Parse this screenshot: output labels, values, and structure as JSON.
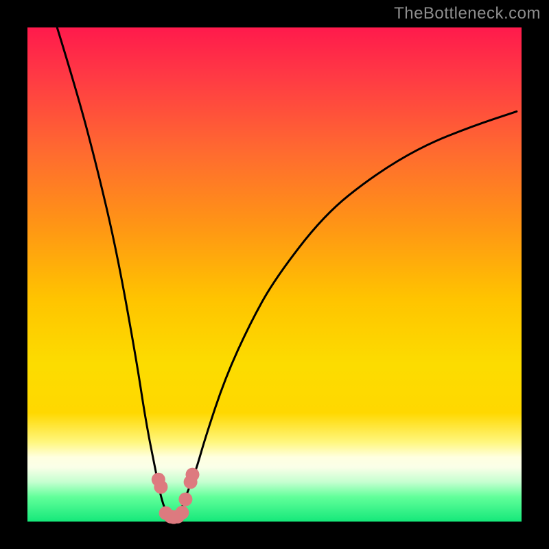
{
  "attribution": "TheBottleneck.com",
  "colors": {
    "frame": "#000000",
    "gradient_top": "#ff1a4c",
    "gradient_mid": "#ffc400",
    "gradient_low": "#fff780",
    "gradient_bottom": "#15e87a",
    "curve_stroke": "#000000",
    "marker_fill": "#dd7a7f"
  },
  "chart_data": {
    "type": "line",
    "title": "",
    "xlabel": "",
    "ylabel": "",
    "xlim": [
      0,
      100
    ],
    "ylim": [
      0,
      100
    ],
    "grid": false,
    "legend": false,
    "series": [
      {
        "name": "bottleneck-curve",
        "x": [
          6,
          10,
          14,
          18,
          22,
          24,
          26,
          27,
          28,
          29,
          30,
          31,
          32,
          34,
          36,
          40,
          45,
          50,
          60,
          70,
          80,
          90,
          99
        ],
        "values": [
          100,
          87,
          72,
          55,
          33,
          20,
          10,
          5,
          2,
          1,
          1,
          2,
          5,
          10,
          17,
          29,
          40,
          49,
          62,
          70,
          76,
          80,
          83
        ]
      }
    ],
    "markers": {
      "name": "highlighted-points",
      "x": [
        26.5,
        27.0,
        28.0,
        29.0,
        29.6,
        30.4,
        31.3,
        32.0,
        33.0,
        33.4
      ],
      "values": [
        8.5,
        7.0,
        1.7,
        1.0,
        0.9,
        1.0,
        1.8,
        4.5,
        8.0,
        9.5
      ],
      "radius_px": 10
    }
  }
}
